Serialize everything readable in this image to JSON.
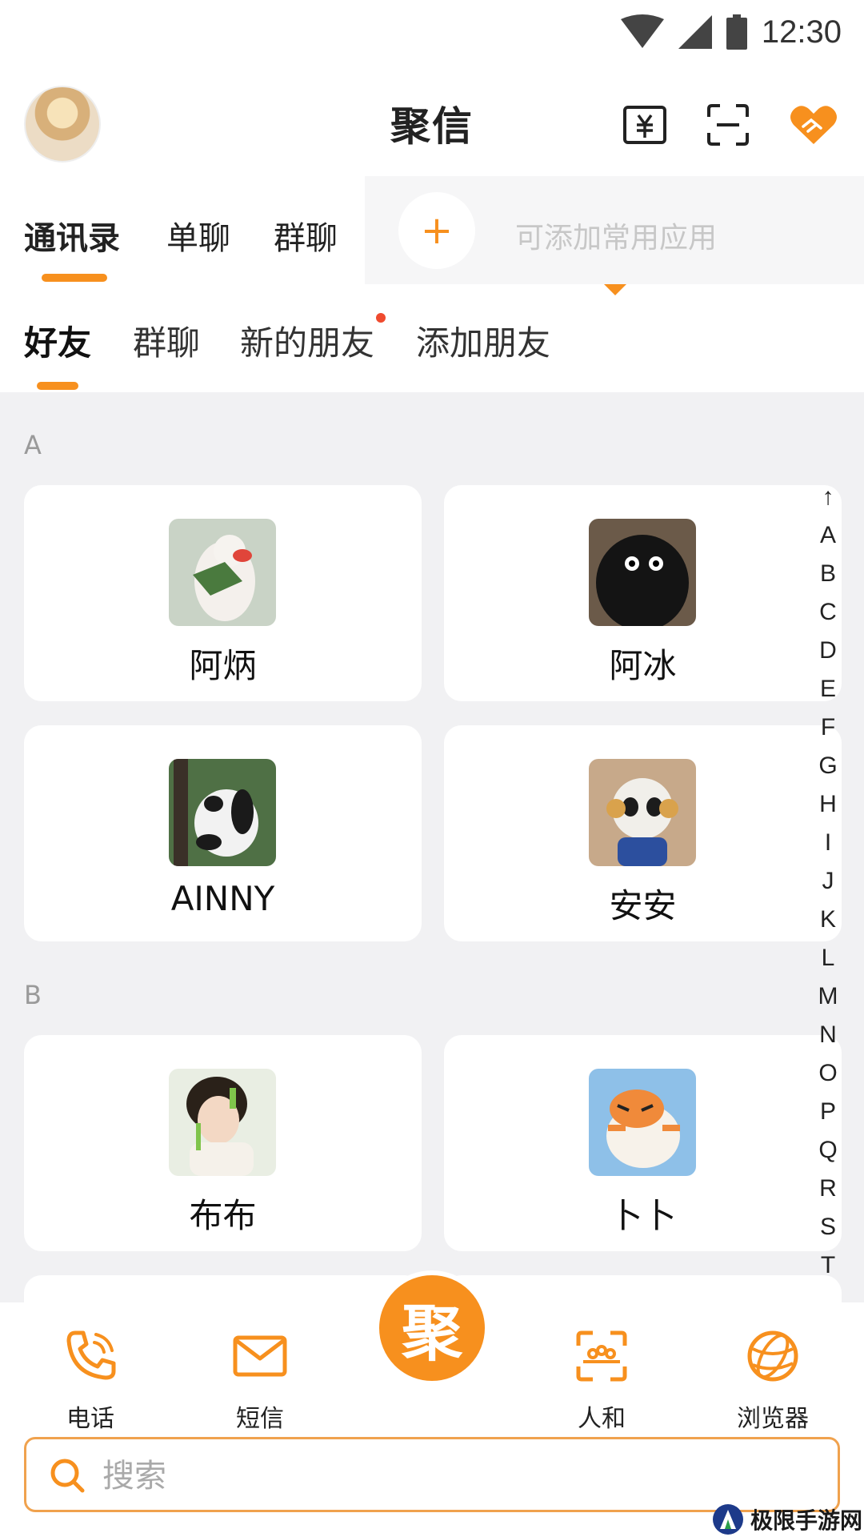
{
  "status_bar": {
    "time": "12:30"
  },
  "header": {
    "title": "聚信"
  },
  "top_tabs": {
    "tabs": [
      {
        "label": "通讯录",
        "active": true
      },
      {
        "label": "单聊",
        "active": false
      },
      {
        "label": "群聊",
        "active": false
      }
    ],
    "add_app_hint": "可添加常用应用"
  },
  "sub_tabs": {
    "tabs": [
      {
        "label": "好友",
        "active": true
      },
      {
        "label": "群聊",
        "active": false
      },
      {
        "label": "新的朋友",
        "active": false,
        "badge_dot": true
      },
      {
        "label": "添加朋友",
        "active": false
      }
    ]
  },
  "contacts": {
    "sections": [
      {
        "letter": "A",
        "items": [
          "阿炳",
          "阿冰",
          "AINNY",
          "安安"
        ]
      },
      {
        "letter": "B",
        "items": [
          "布布",
          "卜卜"
        ]
      }
    ]
  },
  "alphabet_index": [
    "↑",
    "A",
    "B",
    "C",
    "D",
    "E",
    "F",
    "G",
    "H",
    "I",
    "J",
    "K",
    "L",
    "M",
    "N",
    "O",
    "P",
    "Q",
    "R",
    "S",
    "T"
  ],
  "bottom_nav": {
    "items": [
      {
        "label": "电话",
        "icon": "phone-icon"
      },
      {
        "label": "短信",
        "icon": "mail-icon"
      },
      {
        "label": "人和",
        "icon": "people-icon"
      },
      {
        "label": "浏览器",
        "icon": "globe-icon"
      }
    ],
    "center_label": "聚"
  },
  "search": {
    "placeholder": "搜索"
  },
  "watermark": {
    "text": "极限手游网"
  },
  "colors": {
    "accent": "#f7901e",
    "background": "#f1f1f3",
    "badge": "#ef4a2e"
  }
}
